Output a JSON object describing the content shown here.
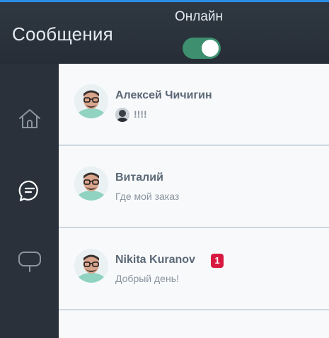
{
  "header": {
    "title": "Сообщения",
    "online_label": "Онлайн",
    "online_enabled": true,
    "accent_color": "#2b8de6",
    "toggle_color": "#3d8f6f"
  },
  "sidebar": {
    "items": [
      {
        "icon": "home-icon",
        "active": false
      },
      {
        "icon": "chat-bubble-icon",
        "active": true
      },
      {
        "icon": "monitor-bubble-icon",
        "active": false
      }
    ]
  },
  "chats": [
    {
      "name": "Алексей Чичигин",
      "preview": "!!!!",
      "has_sender_avatar": true,
      "unread": null
    },
    {
      "name": "Виталий",
      "preview": "Где мой заказ",
      "has_sender_avatar": false,
      "unread": null
    },
    {
      "name": "Nikita Kuranov",
      "preview": "Добрый день!",
      "has_sender_avatar": false,
      "unread": "1"
    }
  ],
  "colors": {
    "badge": "#d8193f",
    "sidebar_bg": "#2a313a",
    "header_bg": "#2f3842"
  }
}
